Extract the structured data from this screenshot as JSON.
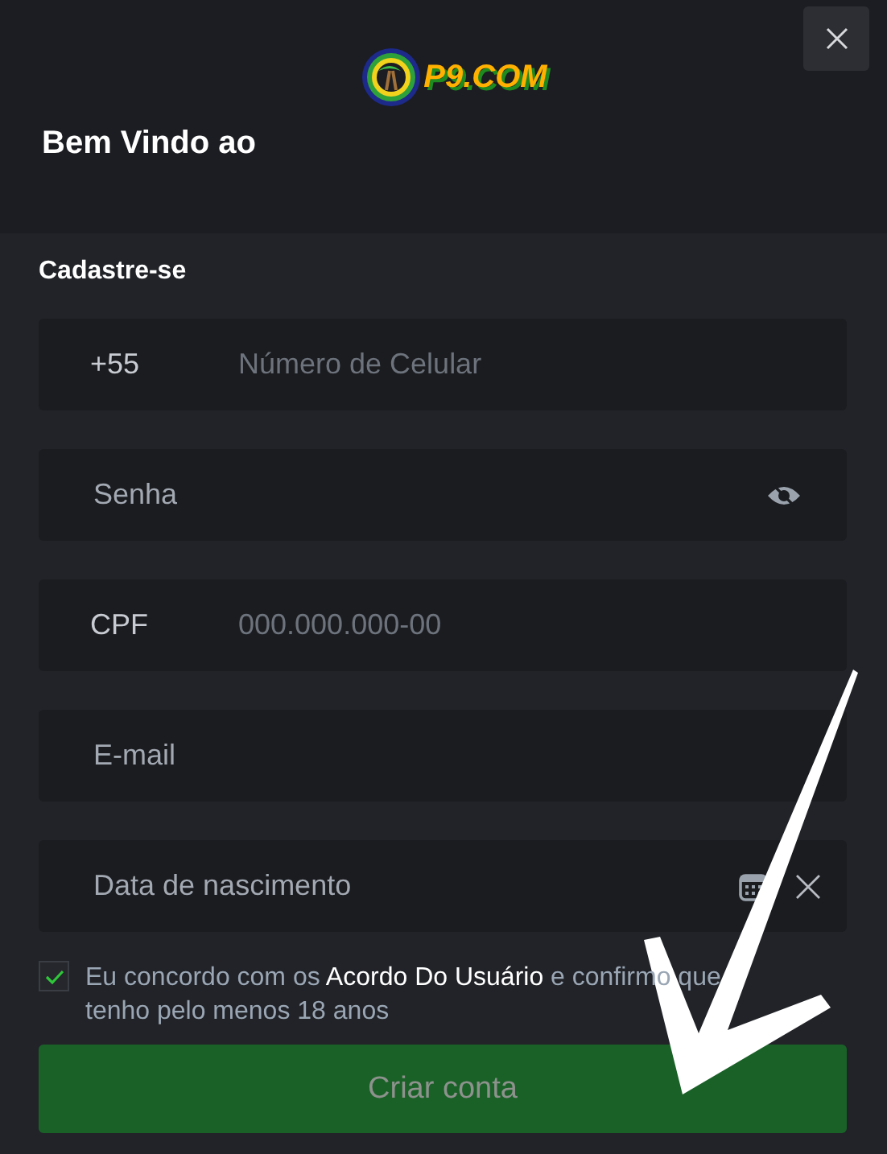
{
  "logo": {
    "text": "P9.COM"
  },
  "heading": "Bem Vindo ao",
  "section_title": "Cadastre-se",
  "fields": [
    {
      "kind": "phone",
      "prefix": "+55",
      "placeholder": "Número de Celular"
    },
    {
      "kind": "password",
      "placeholder": "Senha"
    },
    {
      "kind": "prefixed",
      "prefix": "CPF",
      "placeholder": "000.000.000-00"
    },
    {
      "kind": "plain",
      "placeholder": "E-mail"
    },
    {
      "kind": "date",
      "placeholder": "Data de nascimento"
    }
  ],
  "agreement": {
    "checked": true,
    "text": "Eu concordo com os **Acordo Do Usuário** e confirmo que tenho pelo menos 18 anos"
  },
  "submit": {
    "label": "Criar conta",
    "disabled": true
  }
}
